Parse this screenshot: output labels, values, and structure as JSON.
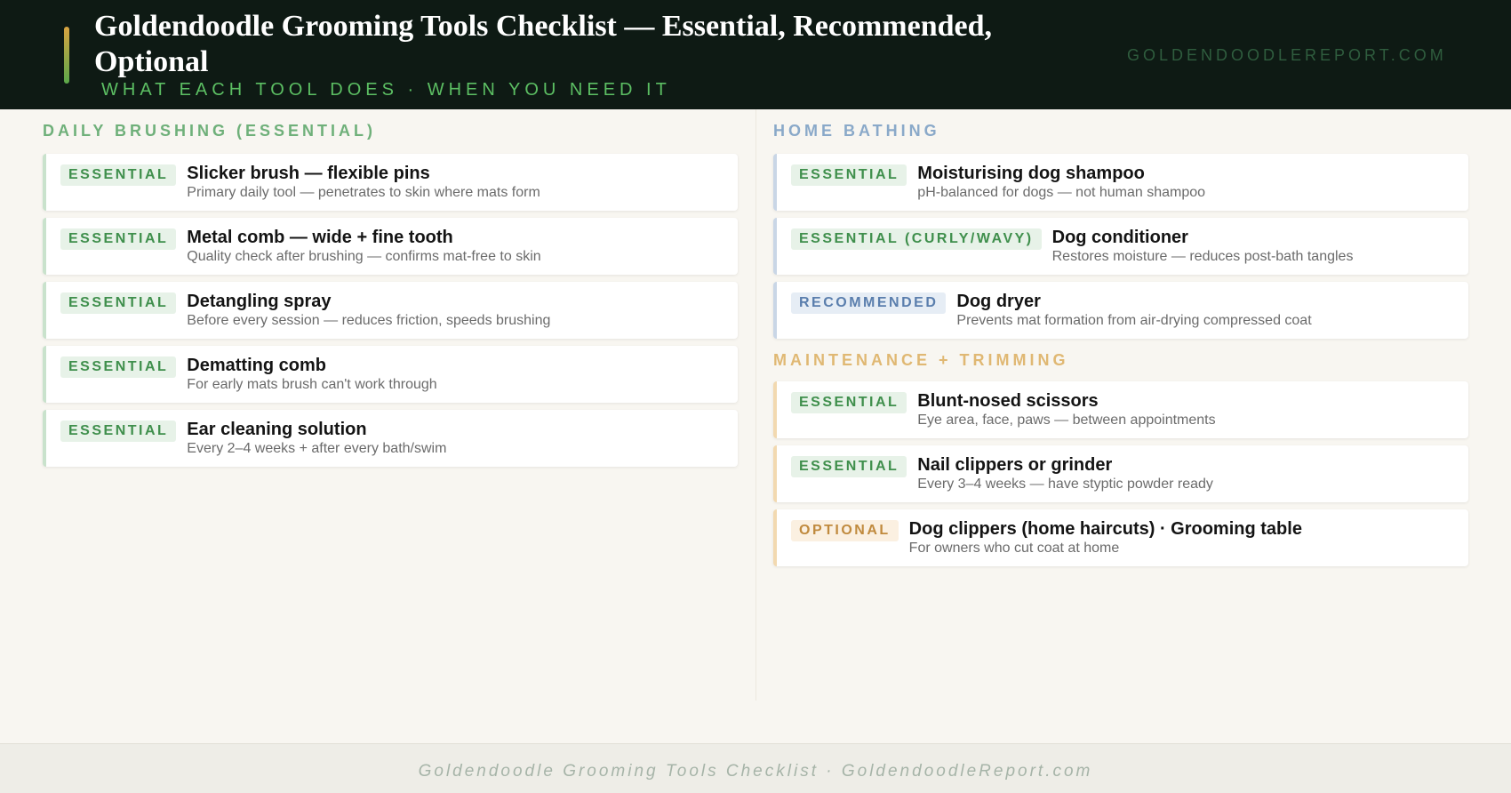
{
  "header": {
    "title": "Goldendoodle Grooming Tools Checklist — Essential, Recommended, Optional",
    "subtitle": "WHAT EACH TOOL DOES · WHEN YOU NEED IT",
    "site": "GOLDENDOODLEREPORT.COM",
    "accent_colors": [
      "#d9a441",
      "#5aa84a"
    ]
  },
  "sections": {
    "daily": {
      "title": "DAILY BRUSHING (ESSENTIAL)",
      "color": "#6fb07a",
      "items": [
        {
          "badge": "ESSENTIAL",
          "name": "Slicker brush — flexible pins",
          "desc": "Primary daily tool — penetrates to skin where mats form"
        },
        {
          "badge": "ESSENTIAL",
          "name": "Metal comb — wide + fine tooth",
          "desc": "Quality check after brushing — confirms mat-free to skin"
        },
        {
          "badge": "ESSENTIAL",
          "name": "Detangling spray",
          "desc": "Before every session — reduces friction, speeds brushing"
        },
        {
          "badge": "ESSENTIAL",
          "name": "Dematting comb",
          "desc": "For early mats brush can't work through"
        },
        {
          "badge": "ESSENTIAL",
          "name": "Ear cleaning solution",
          "desc": "Every 2–4 weeks + after every bath/swim"
        }
      ]
    },
    "bathing": {
      "title": "HOME BATHING",
      "color": "#8aa9c9",
      "items": [
        {
          "badge": "ESSENTIAL",
          "name": "Moisturising dog shampoo",
          "desc": "pH-balanced for dogs — not human shampoo"
        },
        {
          "badge": "ESSENTIAL (CURLY/WAVY)",
          "name": "Dog conditioner",
          "desc": "Restores moisture — reduces post-bath tangles"
        },
        {
          "badge": "RECOMMENDED",
          "name": "Dog dryer",
          "desc": "Prevents mat formation from air-drying compressed coat"
        }
      ]
    },
    "maintenance": {
      "title": "MAINTENANCE + TRIMMING",
      "color": "#e0b873",
      "items": [
        {
          "badge": "ESSENTIAL",
          "name": "Blunt-nosed scissors",
          "desc": "Eye area, face, paws — between appointments"
        },
        {
          "badge": "ESSENTIAL",
          "name": "Nail clippers or grinder",
          "desc": "Every 3–4 weeks — have styptic powder ready"
        },
        {
          "badge": "OPTIONAL",
          "name": "Dog clippers (home haircuts) · Grooming table",
          "desc": "For owners who cut coat at home"
        }
      ]
    }
  },
  "footer": {
    "text": "Goldendoodle Grooming Tools Checklist · GoldendoodleReport.com"
  }
}
